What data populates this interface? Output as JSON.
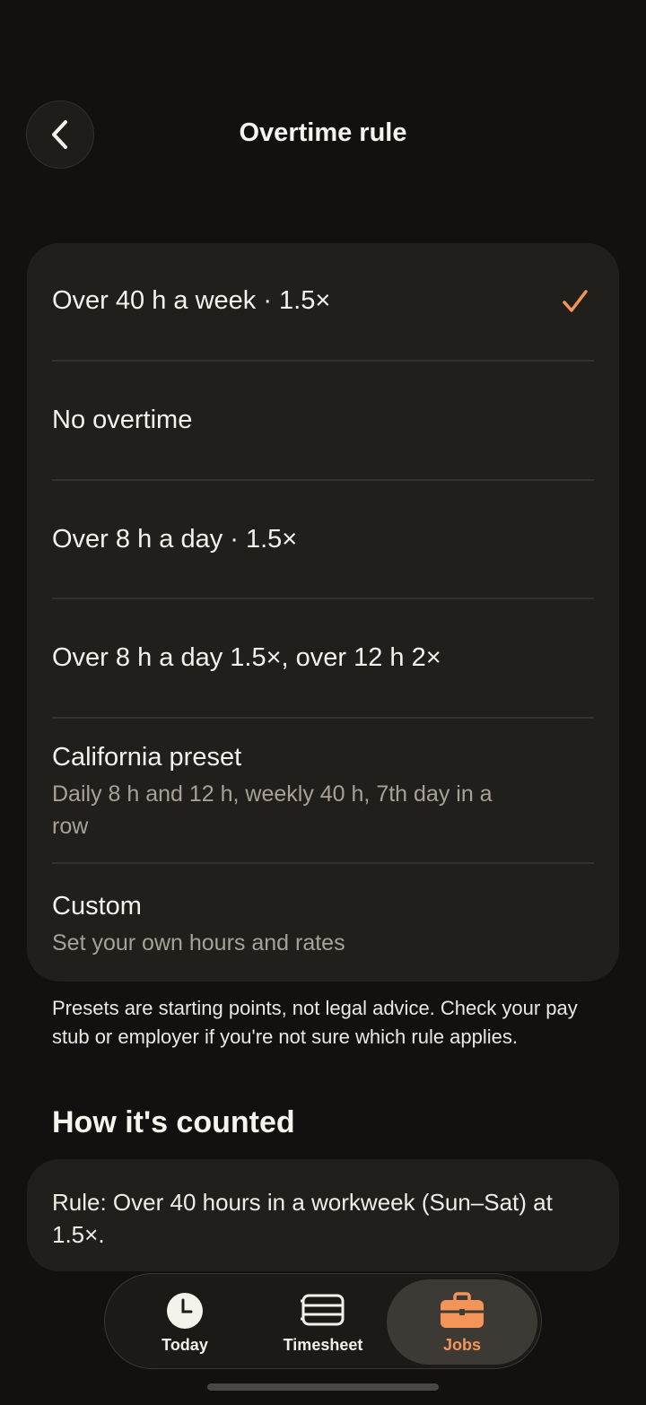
{
  "header": {
    "title": "Overtime rule",
    "back_icon": "chevron-left-icon"
  },
  "options": [
    {
      "label": "Over 40 h a week · 1.5×",
      "selected": true
    },
    {
      "label": "No overtime",
      "selected": false
    },
    {
      "label": "Over 8 h a day · 1.5×",
      "selected": false
    },
    {
      "label": "Over 8 h a day 1.5×, over 12 h 2×",
      "selected": false
    },
    {
      "label": "California preset",
      "sublabel": "Daily 8 h and 12 h, weekly 40 h, 7th day in a row",
      "selected": false
    },
    {
      "label": "Custom",
      "sublabel": "Set your own hours and rates",
      "selected": false
    }
  ],
  "note": "Presets are starting points, not legal advice. Check your pay stub or employer if you're not sure which rule applies.",
  "section": {
    "title": "How it's counted",
    "rule_text": "Rule: Over 40 hours in a workweek (Sun–Sat) at 1.5×."
  },
  "tabbar": {
    "tabs": [
      {
        "label": "Today",
        "icon": "clock-icon",
        "active": false
      },
      {
        "label": "Timesheet",
        "icon": "timesheet-icon",
        "active": false
      },
      {
        "label": "Jobs",
        "icon": "briefcase-icon",
        "active": true
      }
    ]
  },
  "colors": {
    "accent": "#f39558",
    "background": "#121110",
    "card": "#211f1c"
  }
}
